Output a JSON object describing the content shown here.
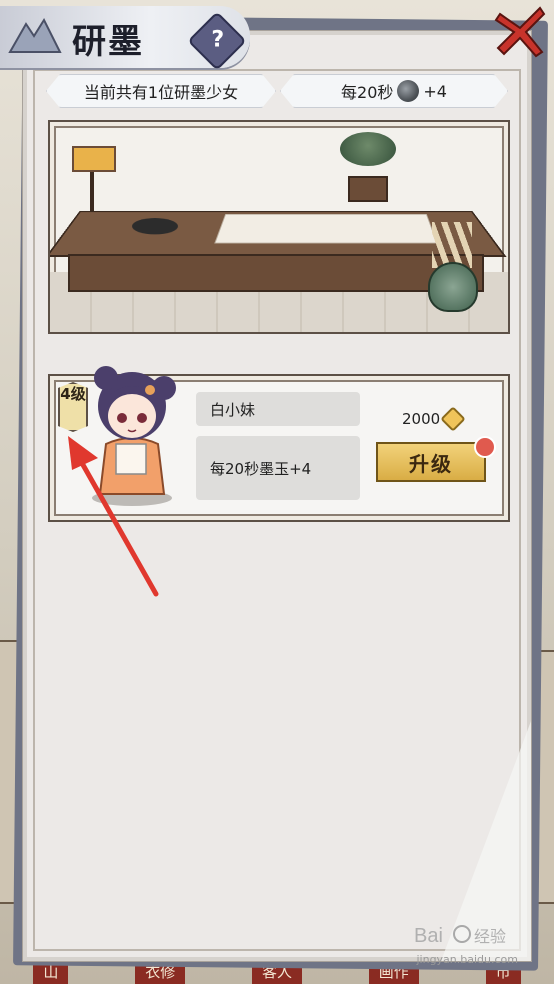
{
  "screen": {
    "title": "研墨",
    "help_label": "?"
  },
  "info": {
    "girls_count_text": "当前共有1位研墨少女",
    "rate_prefix": "每20秒",
    "rate_suffix": "+4",
    "rate_icon": "ink-jade-icon"
  },
  "girl_card": {
    "level_text": "4级",
    "name": "白小妹",
    "effect": "每20秒墨玉+4",
    "upgrade_cost": "2000",
    "cost_icon": "coin-icon",
    "upgrade_label": "升级"
  },
  "bottom_nav": {
    "items": [
      "山",
      "衣修",
      "客人",
      "画作",
      "市"
    ]
  },
  "watermark": {
    "url": "jingyan.baidu.com"
  },
  "colors": {
    "accent_gold": "#d9ad45",
    "arrow_red": "#e0382e",
    "panel_bg": "#ece9e7"
  }
}
